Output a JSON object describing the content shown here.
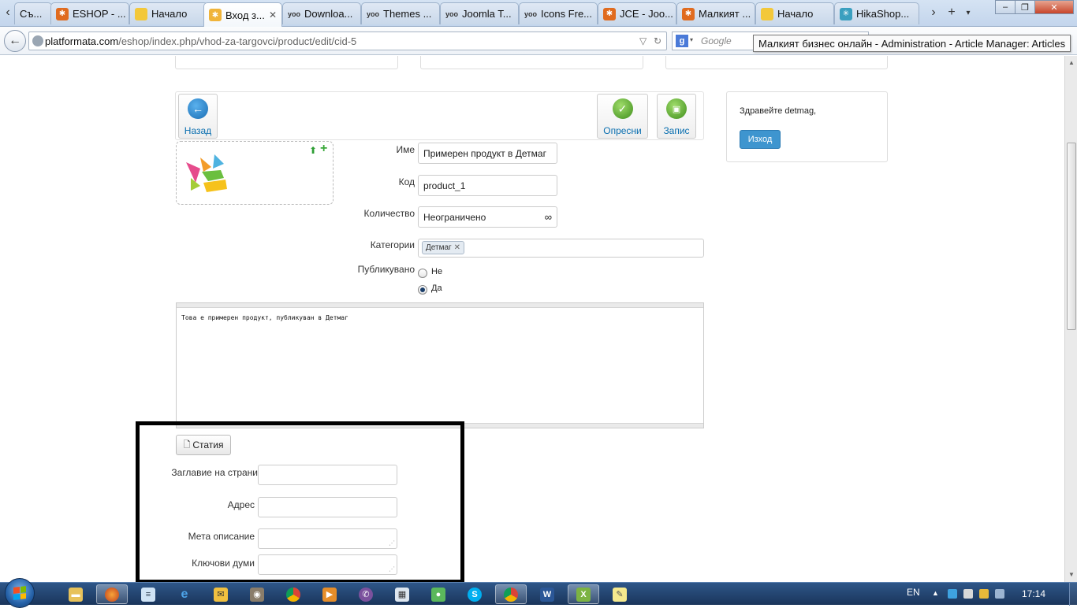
{
  "browser": {
    "tabs": [
      {
        "label": "Съ...",
        "icon": "page-icon",
        "active": false
      },
      {
        "label": "ESHOP - ...",
        "icon": "joomla-icon",
        "active": false
      },
      {
        "label": "Начало",
        "icon": "page-icon",
        "active": false
      },
      {
        "label": "Вход з...",
        "icon": "detmag-icon",
        "active": true
      },
      {
        "label": "Downloa...",
        "icon": "yoo-icon",
        "active": false
      },
      {
        "label": "Themes ...",
        "icon": "yoo-icon",
        "active": false
      },
      {
        "label": "Joomla T...",
        "icon": "yoo-icon",
        "active": false
      },
      {
        "label": "Icons Fre...",
        "icon": "yoo-icon",
        "active": false
      },
      {
        "label": "JCE - Joo...",
        "icon": "joomla-icon",
        "active": false
      },
      {
        "label": "Малкият ...",
        "icon": "joomla-icon",
        "active": false
      },
      {
        "label": "Начало",
        "icon": "page-icon",
        "active": false
      },
      {
        "label": "HikaShop...",
        "icon": "hikashop-icon",
        "active": false
      }
    ],
    "new_tab": "+",
    "url_host": "platformata.com",
    "url_path": "/eshop/index.php/vhod-za-targovci/product/edit/cid-5",
    "search_placeholder": "Google",
    "tooltip": "Малкият бизнес онлайн - Administration - Article Manager: Articles"
  },
  "toolbar": {
    "back_label": "Назад",
    "refresh_label": "Опресни",
    "save_label": "Запис"
  },
  "form": {
    "name_label": "Име",
    "name_value": "Примерен продукт в Детмаг",
    "code_label": "Код",
    "code_value": "product_1",
    "quantity_label": "Количество",
    "quantity_value": "Неограничено",
    "quantity_unlimited_symbol": "∞",
    "categories_label": "Категории",
    "category_tag": "Детмаг",
    "published_label": "Публикувано",
    "published_options": [
      "Не",
      "Да"
    ],
    "published_selected": "Да",
    "description": "Това е примерен продукт, публикуван в Детмаг"
  },
  "seo": {
    "article_button": "Статия",
    "page_title_label": "Заглавие на страни",
    "page_title_value": "",
    "address_label": "Адрес",
    "address_value": "",
    "meta_description_label": "Мета описание",
    "meta_description_value": "",
    "keywords_label": "Ключови думи",
    "keywords_value": ""
  },
  "user": {
    "greeting": "Здравейте detmag,",
    "logout_label": "Изход"
  },
  "taskbar": {
    "language": "EN",
    "clock": "17:14",
    "apps": [
      "explorer",
      "firefox",
      "notepad",
      "ie",
      "outlook",
      "gimp",
      "chrome",
      "media",
      "viber",
      "calculator",
      "messenger",
      "skype",
      "chrome2",
      "word",
      "excel",
      "sticky-notes"
    ]
  },
  "colors": {
    "accent_blue": "#3e95cf",
    "link_blue": "#0a6fb0",
    "refresh_green": "#5aa832",
    "highlight_border": "#000000"
  }
}
